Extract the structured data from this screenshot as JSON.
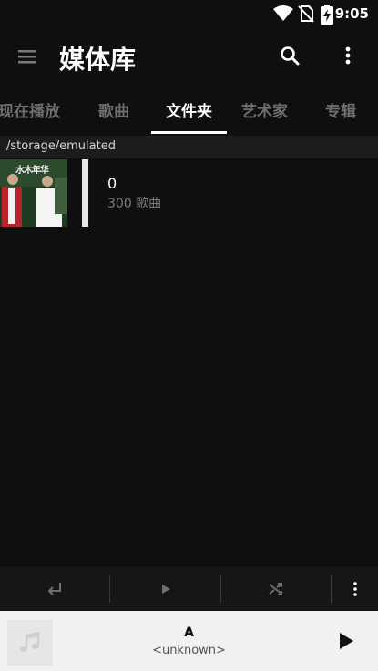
{
  "status_bar": {
    "time": "9:05"
  },
  "app_bar": {
    "title": "媒体库"
  },
  "tabs": [
    {
      "label": "现在播放"
    },
    {
      "label": "歌曲"
    },
    {
      "label": "文件夹"
    },
    {
      "label": "艺术家"
    },
    {
      "label": "专辑"
    }
  ],
  "path": "/storage/emulated",
  "folders": [
    {
      "name": "0",
      "count": "300 歌曲",
      "album_art_text": "水木年华"
    }
  ],
  "now_playing": {
    "title": "A",
    "artist": "<unknown>"
  },
  "colors": {
    "background": "#0f0f0f",
    "tab_inactive": "#6e6e6e",
    "now_playing_bg": "#f1f1f1"
  }
}
